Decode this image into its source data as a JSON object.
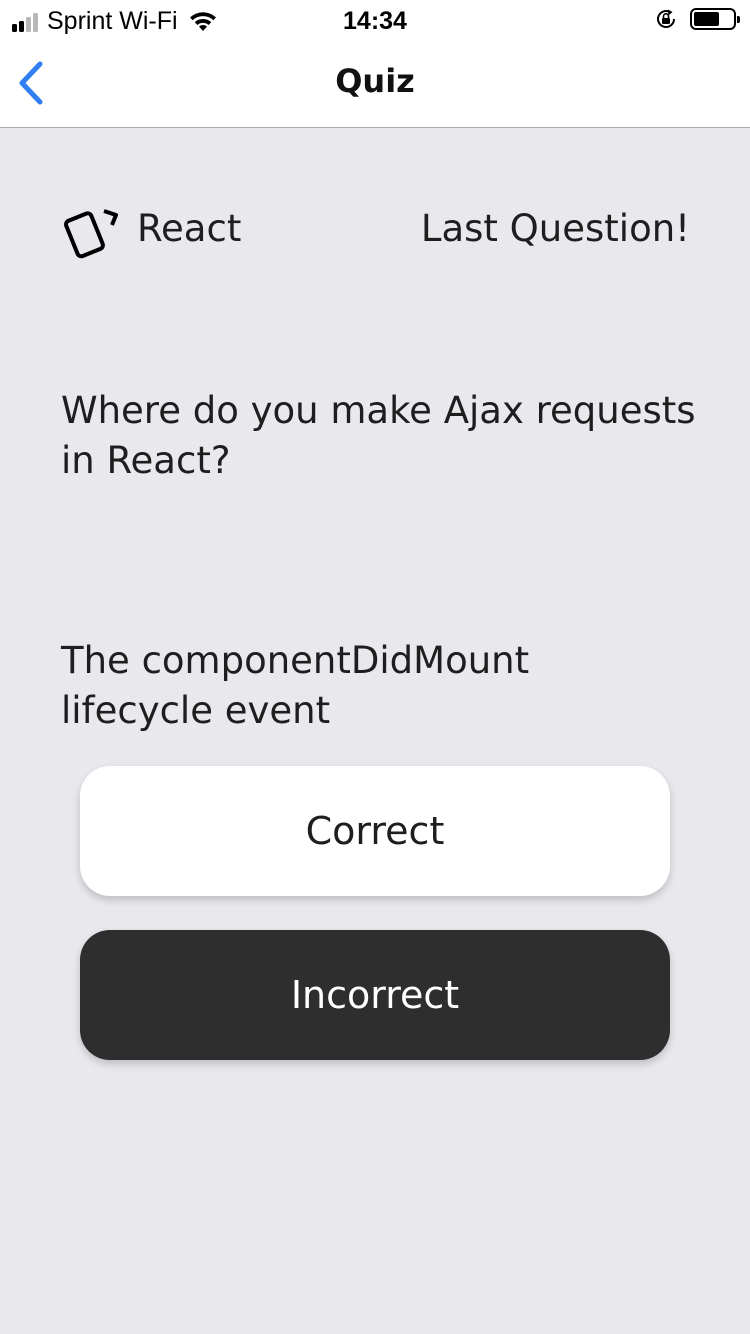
{
  "status_bar": {
    "carrier": "Sprint Wi-Fi",
    "time": "14:34",
    "signal_bars_filled": 2,
    "signal_bars_total": 4,
    "battery_level": 0.65,
    "icons": [
      "signal-icon",
      "wifi-icon",
      "orientation-lock-icon",
      "battery-icon"
    ]
  },
  "nav": {
    "title": "Quiz",
    "back_icon": "chevron-left-icon",
    "accent_color": "#2f7ff2"
  },
  "quiz": {
    "deck_icon": "cards-icon",
    "deck_name": "React",
    "progress_text": "Last Question!",
    "question": "Where do you make Ajax requests in React?",
    "answer": "The componentDidMount lifecycle event",
    "correct_label": "Correct",
    "incorrect_label": "Incorrect"
  },
  "colors": {
    "background": "#e8e8ed",
    "correct_button": "#ffffff",
    "incorrect_button": "#2e2e2e"
  }
}
